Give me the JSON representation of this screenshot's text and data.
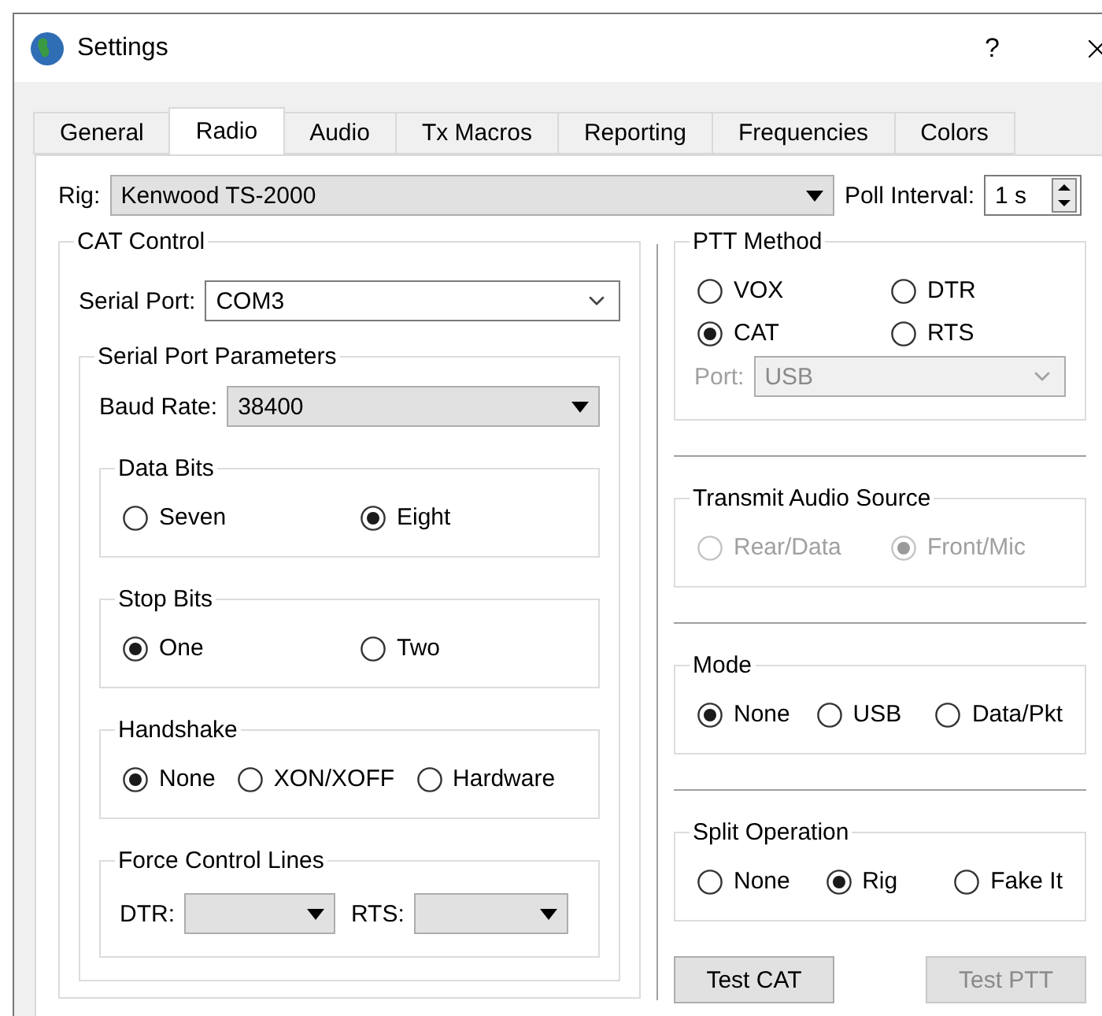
{
  "window": {
    "title": "Settings",
    "help": "?"
  },
  "tabs": [
    {
      "label": "General",
      "selected": false
    },
    {
      "label": "Radio",
      "selected": true
    },
    {
      "label": "Audio",
      "selected": false
    },
    {
      "label": "Tx Macros",
      "selected": false
    },
    {
      "label": "Reporting",
      "selected": false
    },
    {
      "label": "Frequencies",
      "selected": false
    },
    {
      "label": "Colors",
      "selected": false
    }
  ],
  "rig": {
    "label": "Rig:",
    "value": "Kenwood TS-2000"
  },
  "poll_interval": {
    "label": "Poll Interval:",
    "value": "1 s"
  },
  "cat_control": {
    "title": "CAT Control",
    "serial_port": {
      "label": "Serial Port:",
      "value": "COM3"
    },
    "parameters": {
      "title": "Serial Port Parameters",
      "baud_rate": {
        "label": "Baud Rate:",
        "value": "38400"
      },
      "groups": [
        {
          "title": "Data Bits",
          "options": [
            {
              "label": "Seven",
              "selected": false,
              "disabled": false
            },
            {
              "label": "Eight",
              "selected": true,
              "disabled": false
            }
          ]
        },
        {
          "title": "Stop Bits",
          "options": [
            {
              "label": "One",
              "selected": true,
              "disabled": false
            },
            {
              "label": "Two",
              "selected": false,
              "disabled": false
            }
          ]
        },
        {
          "title": "Handshake",
          "options": [
            {
              "label": "None",
              "selected": true,
              "disabled": false
            },
            {
              "label": "XON/XOFF",
              "selected": false,
              "disabled": false
            },
            {
              "label": "Hardware",
              "selected": false,
              "disabled": false
            }
          ]
        }
      ],
      "force_control_lines": {
        "title": "Force Control Lines",
        "dtr": {
          "label": "DTR:"
        },
        "rts": {
          "label": "RTS:"
        }
      }
    }
  },
  "right_groups": [
    {
      "title": "PTT Method",
      "options": [
        {
          "label": "VOX",
          "selected": false,
          "disabled": false
        },
        {
          "label": "DTR",
          "selected": false,
          "disabled": false
        },
        {
          "label": "CAT",
          "selected": true,
          "disabled": false
        },
        {
          "label": "RTS",
          "selected": false,
          "disabled": false
        }
      ],
      "port": {
        "label": "Port:",
        "value": "USB",
        "disabled": true
      }
    },
    {
      "title": "Transmit Audio Source",
      "options": [
        {
          "label": "Rear/Data",
          "selected": false,
          "disabled": true
        },
        {
          "label": "Front/Mic",
          "selected": true,
          "disabled": true
        }
      ]
    },
    {
      "title": "Mode",
      "options": [
        {
          "label": "None",
          "selected": true,
          "disabled": false
        },
        {
          "label": "USB",
          "selected": false,
          "disabled": false
        },
        {
          "label": "Data/Pkt",
          "selected": false,
          "disabled": false
        }
      ]
    },
    {
      "title": "Split Operation",
      "options": [
        {
          "label": "None",
          "selected": false,
          "disabled": false
        },
        {
          "label": "Rig",
          "selected": true,
          "disabled": false
        },
        {
          "label": "Fake It",
          "selected": false,
          "disabled": false
        }
      ]
    }
  ],
  "buttons": [
    {
      "label": "Test CAT",
      "disabled": false
    },
    {
      "label": "Test PTT",
      "disabled": true
    }
  ]
}
